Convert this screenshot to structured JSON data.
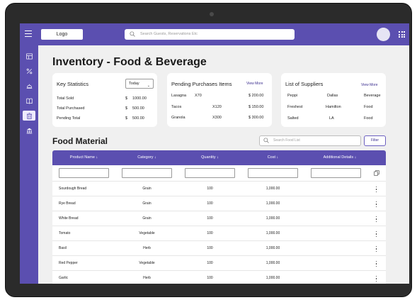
{
  "topbar": {
    "logo_label": "Logo",
    "search_placeholder": "Search Guests, Reservations Etc"
  },
  "page": {
    "title": "Inventory - Food & Beverage"
  },
  "key_statistics": {
    "title": "Key Statistics",
    "period": "Today",
    "rows": [
      {
        "label": "Total Sold",
        "currency": "$",
        "amount": "1000.00"
      },
      {
        "label": "Total Purchased",
        "currency": "$",
        "amount": "500.00"
      },
      {
        "label": "Pending Total",
        "currency": "$",
        "amount": "500.00"
      }
    ]
  },
  "pending_purchases": {
    "title": "Pending Purchases Items",
    "view_more": "View More",
    "rows": [
      {
        "item": "Lasagna",
        "qty": "X70",
        "amount": "$ 200.00"
      },
      {
        "item": "Tacos",
        "qty": "X120",
        "amount": "$ 150.00"
      },
      {
        "item": "Granola",
        "qty": "X300",
        "amount": "$ 300.00"
      }
    ]
  },
  "suppliers": {
    "title": "List of Suppliers",
    "view_more": "View More",
    "rows": [
      {
        "name": "Peppi",
        "city": "Dallas",
        "category": "Beverage"
      },
      {
        "name": "Freshest",
        "city": "Hamilton",
        "category": "Food"
      },
      {
        "name": "Salted",
        "city": "LA",
        "category": "Food"
      }
    ]
  },
  "food_material": {
    "title": "Food Material",
    "search_placeholder": "Search Food List",
    "filter_label": "Filter",
    "columns": [
      "Product Name ↓",
      "Category ↓",
      "Quantity ↓",
      "Cost ↓",
      "Additional Details ↓"
    ],
    "rows": [
      {
        "name": "Sourdough Bread",
        "category": "Grain",
        "quantity": "100",
        "cost": "1,000.00"
      },
      {
        "name": "Rye Bread",
        "category": "Grain",
        "quantity": "100",
        "cost": "1,000.00"
      },
      {
        "name": "White Bread",
        "category": "Grain",
        "quantity": "100",
        "cost": "1,000.00"
      },
      {
        "name": "Tomato",
        "category": "Vegetable",
        "quantity": "100",
        "cost": "1,000.00"
      },
      {
        "name": "Basil",
        "category": "Herb",
        "quantity": "100",
        "cost": "1,000.00"
      },
      {
        "name": "Red Pepper",
        "category": "Vegetable",
        "quantity": "100",
        "cost": "1,000.00"
      },
      {
        "name": "Garlic",
        "category": "Herb",
        "quantity": "100",
        "cost": "1,000.00"
      }
    ]
  },
  "icons": {
    "menu": "hamburger-menu-icon",
    "search": "search-icon",
    "apps": "apps-grid-icon",
    "sidebar": [
      "dashboard-icon",
      "percentage-icon",
      "concierge-bell-icon",
      "book-icon",
      "trash-icon",
      "bank-icon"
    ],
    "row_actions": "kebab-menu-icon",
    "copy": "copy-icon"
  },
  "colors": {
    "primary": "#5b4fb0",
    "background": "#f0f0f0",
    "active_sidebar": "#eeeaff"
  }
}
